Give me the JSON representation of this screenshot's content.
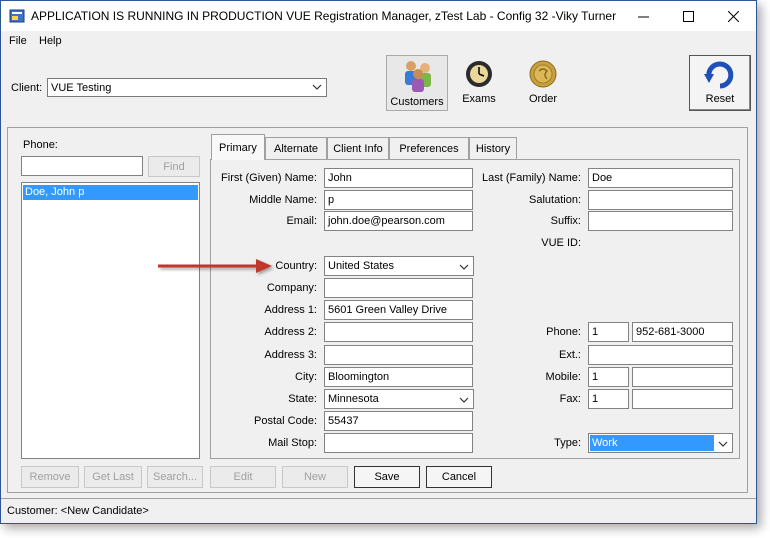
{
  "window": {
    "title": "APPLICATION IS RUNNING IN PRODUCTION  VUE Registration Manager, zTest Lab - Config 32 -Viky Turner"
  },
  "menu": [
    "File",
    "Help"
  ],
  "client": {
    "label": "Client:",
    "value": "VUE Testing"
  },
  "toolbar": {
    "customers": "Customers",
    "exams": "Exams",
    "order": "Order",
    "reset": "Reset"
  },
  "left": {
    "phone_label": "Phone:",
    "phone_value": "",
    "find": "Find",
    "results": [
      "Doe, John p"
    ]
  },
  "tabs": [
    "Primary",
    "Alternate",
    "Client Info",
    "Preferences",
    "History"
  ],
  "form": {
    "first_name_label": "First (Given) Name:",
    "first_name": "John",
    "middle_name_label": "Middle Name:",
    "middle_name": "p",
    "email_label": "Email:",
    "email": "john.doe@pearson.com",
    "country_label": "Country:",
    "country": "United States",
    "company_label": "Company:",
    "company": "",
    "address1_label": "Address 1:",
    "address1": "5601 Green Valley Drive",
    "address2_label": "Address 2:",
    "address2": "",
    "address3_label": "Address 3:",
    "address3": "",
    "city_label": "City:",
    "city": "Bloomington",
    "state_label": "State:",
    "state": "Minnesota",
    "postal_label": "Postal Code:",
    "postal": "55437",
    "mailstop_label": "Mail Stop:",
    "mailstop": "",
    "last_name_label": "Last (Family) Name:",
    "last_name": "Doe",
    "salutation_label": "Salutation:",
    "salutation": "",
    "suffix_label": "Suffix:",
    "suffix": "",
    "vue_id_label": "VUE ID:",
    "vue_id": "",
    "phone_label": "Phone:",
    "phone_country": "1",
    "phone_number": "952-681-3000",
    "ext_label": "Ext.:",
    "ext": "",
    "mobile_label": "Mobile:",
    "mobile_country": "1",
    "mobile_number": "",
    "fax_label": "Fax:",
    "fax_country": "1",
    "fax_number": "",
    "type_label": "Type:",
    "type": "Work"
  },
  "buttons": {
    "remove": "Remove",
    "get_last": "Get Last",
    "search": "Search...",
    "edit": "Edit",
    "new": "New",
    "save": "Save",
    "cancel": "Cancel"
  },
  "status": "Customer: <New Candidate>",
  "colors": {
    "selection": "#3399ff",
    "accent_blue": "#1f4fb8",
    "arrow": "#c0392b"
  },
  "icons": [
    "app-icon",
    "minimize-icon",
    "maximize-icon",
    "close-icon",
    "customers-icon",
    "exams-icon",
    "order-icon",
    "reset-icon",
    "chevron-down-icon"
  ]
}
